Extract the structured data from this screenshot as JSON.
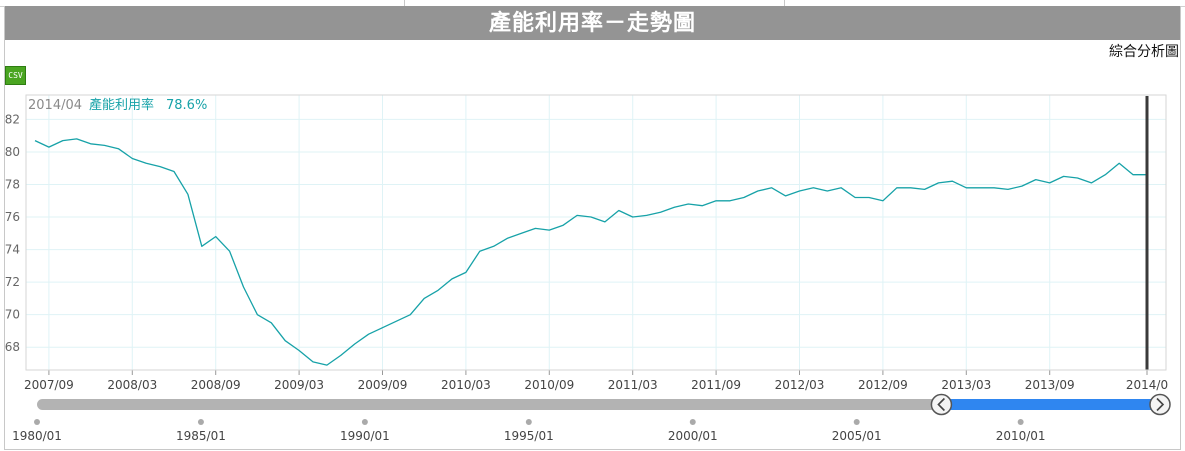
{
  "page": {
    "title": "產能利用率－走勢圖",
    "analysis_link": "綜合分析圖",
    "csv_label": "CSV"
  },
  "colors": {
    "line": "#17a2a8",
    "grid": "#dff3f6",
    "navigator_track": "#b3b3b3",
    "navigator_selected": "#2f86f0",
    "title_bar": "#949494"
  },
  "tooltip": {
    "date": "2014/04",
    "series_label": "產能利用率",
    "value_text": "78.6%"
  },
  "chart_data": {
    "type": "line",
    "series": [
      {
        "name": "產能利用率",
        "x": [
          "2007/08",
          "2007/09",
          "2007/10",
          "2007/11",
          "2007/12",
          "2008/01",
          "2008/02",
          "2008/03",
          "2008/04",
          "2008/05",
          "2008/06",
          "2008/07",
          "2008/08",
          "2008/09",
          "2008/10",
          "2008/11",
          "2008/12",
          "2009/01",
          "2009/02",
          "2009/03",
          "2009/04",
          "2009/05",
          "2009/06",
          "2009/07",
          "2009/08",
          "2009/09",
          "2009/10",
          "2009/11",
          "2009/12",
          "2010/01",
          "2010/02",
          "2010/03",
          "2010/04",
          "2010/05",
          "2010/06",
          "2010/07",
          "2010/08",
          "2010/09",
          "2010/10",
          "2010/11",
          "2010/12",
          "2011/01",
          "2011/02",
          "2011/03",
          "2011/04",
          "2011/05",
          "2011/06",
          "2011/07",
          "2011/08",
          "2011/09",
          "2011/10",
          "2011/11",
          "2011/12",
          "2012/01",
          "2012/02",
          "2012/03",
          "2012/04",
          "2012/05",
          "2012/06",
          "2012/07",
          "2012/08",
          "2012/09",
          "2012/10",
          "2012/11",
          "2012/12",
          "2013/01",
          "2013/02",
          "2013/03",
          "2013/04",
          "2013/05",
          "2013/06",
          "2013/07",
          "2013/08",
          "2013/09",
          "2013/10",
          "2013/11",
          "2013/12",
          "2014/01",
          "2014/02",
          "2014/03",
          "2014/04"
        ],
        "values": [
          80.7,
          80.3,
          80.7,
          80.8,
          80.5,
          80.4,
          80.2,
          79.6,
          79.3,
          79.1,
          78.8,
          77.4,
          74.2,
          74.8,
          73.9,
          71.7,
          70.0,
          69.5,
          68.4,
          67.8,
          67.1,
          66.9,
          67.5,
          68.2,
          68.8,
          69.2,
          69.6,
          70.0,
          71.0,
          71.5,
          72.2,
          72.6,
          73.9,
          74.2,
          74.7,
          75.0,
          75.3,
          75.2,
          75.5,
          76.1,
          76.0,
          75.7,
          76.4,
          76.0,
          76.1,
          76.3,
          76.6,
          76.8,
          76.7,
          77.0,
          77.0,
          77.2,
          77.6,
          77.8,
          77.3,
          77.6,
          77.8,
          77.6,
          77.8,
          77.2,
          77.2,
          77.0,
          77.8,
          77.8,
          77.7,
          78.1,
          78.2,
          77.8,
          77.8,
          77.8,
          77.7,
          77.9,
          78.3,
          78.1,
          78.5,
          78.4,
          78.1,
          78.6,
          79.3,
          78.6,
          78.6
        ]
      }
    ],
    "x_ticks": [
      "2007/09",
      "2008/03",
      "2008/09",
      "2009/03",
      "2009/09",
      "2010/03",
      "2010/09",
      "2011/03",
      "2011/09",
      "2012/03",
      "2012/09",
      "2013/03",
      "2013/09",
      "2014/0"
    ],
    "y_ticks": [
      "68",
      "70",
      "72",
      "74",
      "76",
      "78",
      "80",
      "82"
    ],
    "ylim": [
      66.6,
      83.5
    ],
    "grid": true,
    "navigator": {
      "labels": [
        "1980/01",
        "1985/01",
        "1990/01",
        "1995/01",
        "2000/01",
        "2005/01",
        "2010/01"
      ],
      "range": [
        "1980/01",
        "2014/04"
      ],
      "selected": [
        "2007/08",
        "2014/04"
      ]
    }
  }
}
